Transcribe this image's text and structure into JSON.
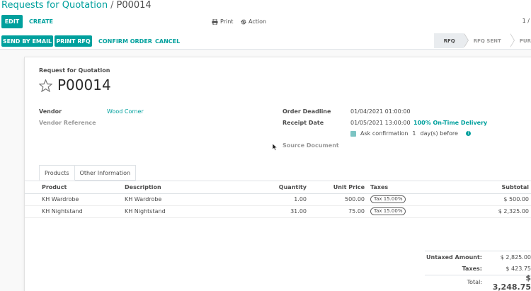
{
  "breadcrumb": {
    "parent": "Requests for Quotation",
    "separator": "/",
    "current": "P00014"
  },
  "toolbar": {
    "edit": "EDIT",
    "create": "CREATE",
    "print": "Print",
    "action": "Action",
    "pager": "1 /"
  },
  "buttons": {
    "send_email": "SEND BY EMAIL",
    "print_rfq": "PRINT RFQ",
    "confirm": "CONFIRM ORDER",
    "cancel": "CANCEL"
  },
  "status_stages": [
    "RFQ",
    "RFQ SENT",
    "PUR"
  ],
  "form": {
    "type_label": "Request for Quotation",
    "name": "P00014",
    "vendor_label": "Vendor",
    "vendor_value": "Wood Corner",
    "vendor_ref_label": "Vendor Reference",
    "deadline_label": "Order Deadline",
    "deadline_value": "01/04/2021 01:00:00",
    "receipt_label": "Receipt Date",
    "receipt_value": "01/05/2021 13:00:00",
    "on_time": "100% On-Time Delivery",
    "ask_confirm_prefix": "Ask confirmation",
    "ask_confirm_days": "1",
    "ask_confirm_suffix": "day(s) before",
    "source_doc_label": "Source Document"
  },
  "tabs": [
    "Products",
    "Other Information"
  ],
  "lines": {
    "headers": [
      "Product",
      "Description",
      "Quantity",
      "Unit Price",
      "Taxes",
      "Subtotal"
    ],
    "rows": [
      {
        "product": "KH Wardrobe",
        "description": "KH Wardrobe",
        "quantity": "1.00",
        "unit_price": "500.00",
        "tax": "Tax 15.00%",
        "subtotal": "$ 500.00"
      },
      {
        "product": "KH Nightstand",
        "description": "KH Nightstand",
        "quantity": "31.00",
        "unit_price": "75.00",
        "tax": "Tax 15.00%",
        "subtotal": "$ 2,325.00"
      }
    ]
  },
  "totals": {
    "untaxed_label": "Untaxed Amount:",
    "untaxed_value": "$ 2,825.00",
    "taxes_label": "Taxes:",
    "taxes_value": "$ 423.75",
    "total_label": "Total:",
    "total_value": "$ 3,248.75"
  },
  "colors": {
    "accent": "#00a09d",
    "text": "#4c4c4c"
  }
}
